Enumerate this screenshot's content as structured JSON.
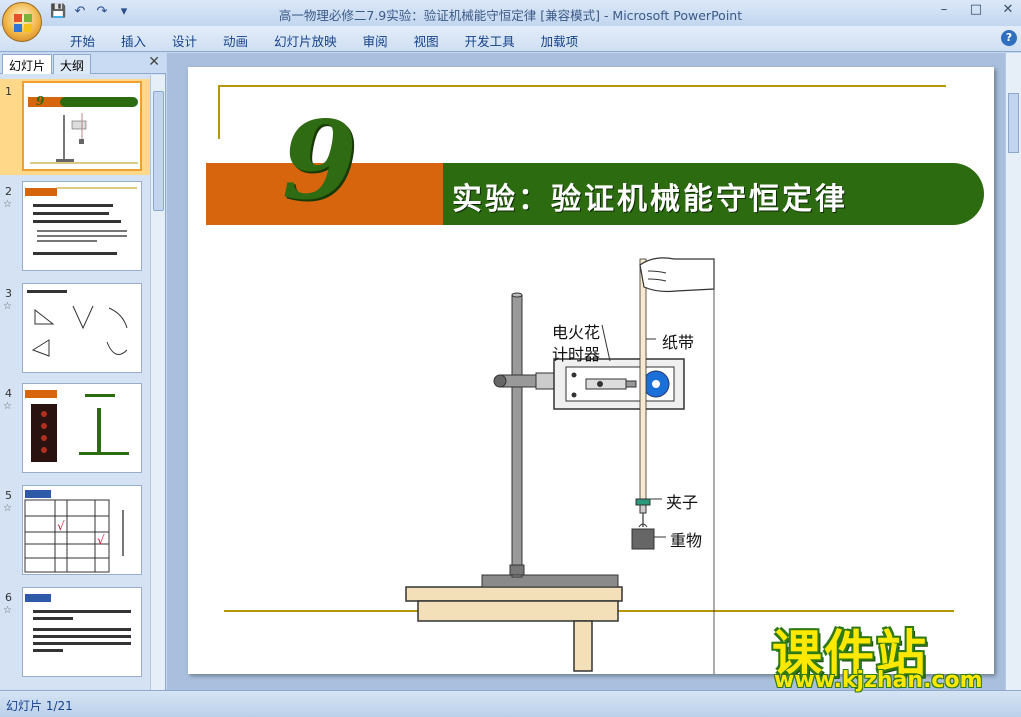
{
  "window": {
    "title": "高一物理必修二7.9实验：验证机械能守恒定律 [兼容模式] - Microsoft PowerPoint"
  },
  "quick_access": {
    "icons": [
      "save-icon",
      "undo-icon",
      "redo-icon",
      "customize-icon"
    ]
  },
  "ribbon": {
    "tabs": [
      "开始",
      "插入",
      "设计",
      "动画",
      "幻灯片放映",
      "审阅",
      "视图",
      "开发工具",
      "加载项"
    ]
  },
  "panel": {
    "tab_slides": "幻灯片",
    "tab_outline": "大纲"
  },
  "thumbnails": [
    {
      "num": "1",
      "selected": true
    },
    {
      "num": "2",
      "selected": false
    },
    {
      "num": "3",
      "selected": false
    },
    {
      "num": "4",
      "selected": false
    },
    {
      "num": "5",
      "selected": false
    },
    {
      "num": "6",
      "selected": false
    }
  ],
  "slide": {
    "number_mark": "9",
    "title": "实验：验证机械能守恒定律",
    "labels": {
      "timer_line1": "电火花",
      "timer_line2": "计时器",
      "tape": "纸带",
      "clip": "夹子",
      "weight": "重物"
    },
    "colors": {
      "orange": "#d7650e",
      "green": "#2c6b10",
      "gold": "#b8960a"
    }
  },
  "status": {
    "slide_counter": "幻灯片 1/21"
  },
  "watermark": {
    "text": "课件站",
    "url": "www.kjzhan.com"
  }
}
